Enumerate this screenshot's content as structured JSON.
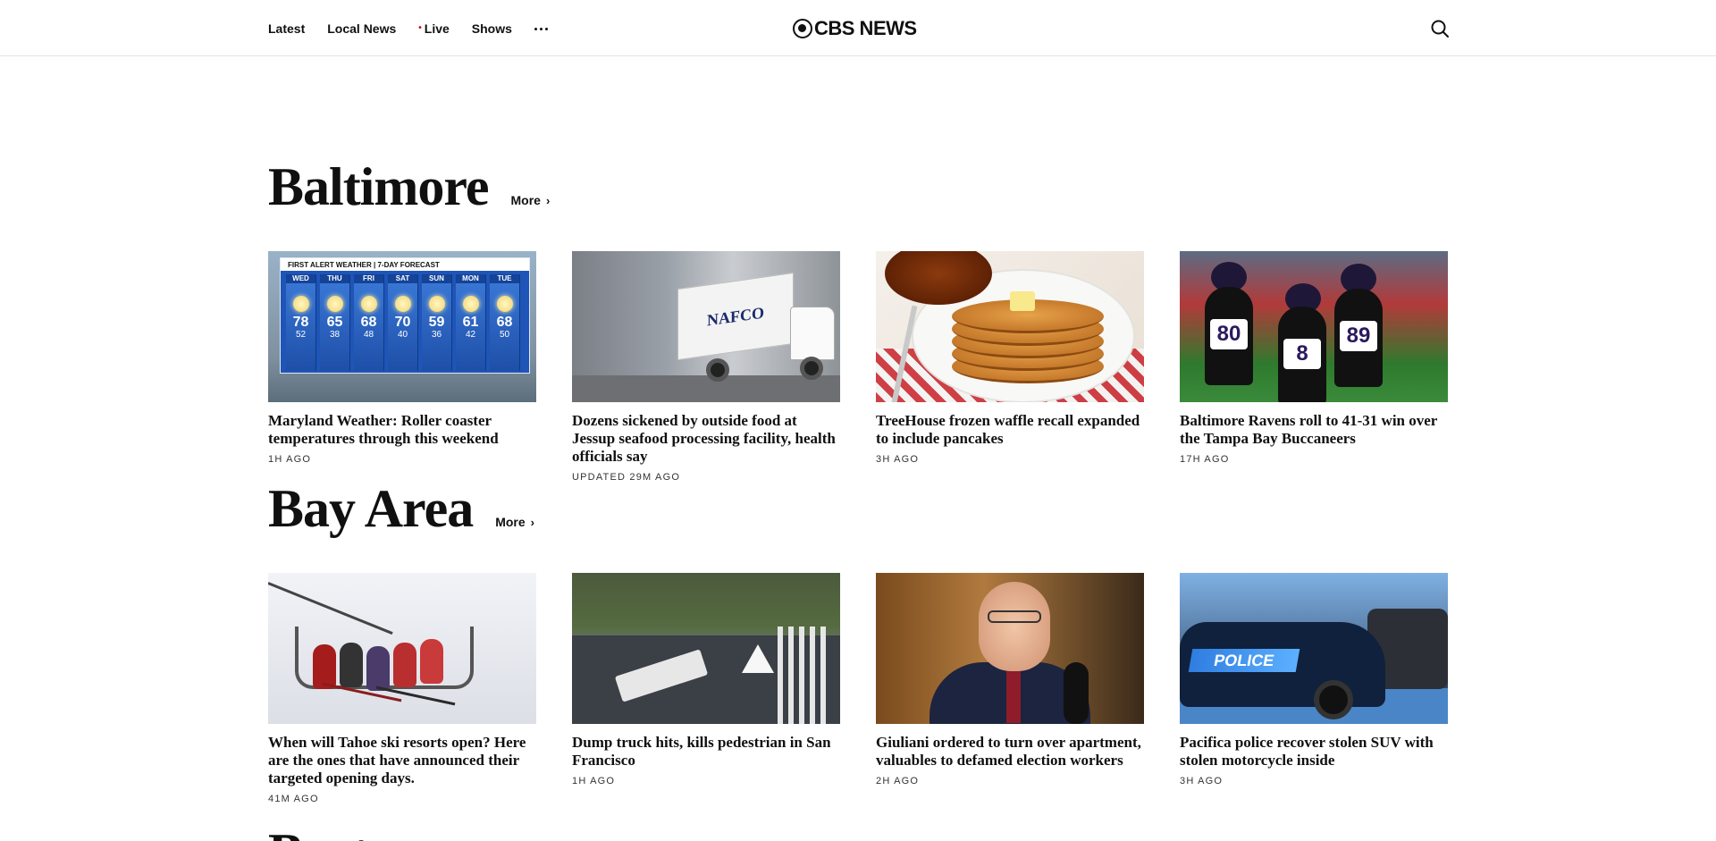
{
  "header": {
    "nav": [
      {
        "label": "Latest"
      },
      {
        "label": "Local News"
      },
      {
        "label": "Live",
        "live_dot": "•"
      },
      {
        "label": "Shows"
      }
    ],
    "logo_text": "CBS NEWS"
  },
  "sections": [
    {
      "title": "Baltimore",
      "more_label": "More",
      "cards": [
        {
          "headline": "Maryland Weather: Roller coaster temperatures through this weekend",
          "time": "1H AGO",
          "image": "weather-forecast-graphic"
        },
        {
          "headline": "Dozens sickened by outside food at Jessup seafood processing facility, health officials say",
          "time": "UPDATED 29M AGO",
          "image": "nafco-truck"
        },
        {
          "headline": "TreeHouse frozen waffle recall expanded to include pancakes",
          "time": "3H AGO",
          "image": "pancakes-with-syrup"
        },
        {
          "headline": "Baltimore Ravens roll to 41-31 win over the Tampa Bay Buccaneers",
          "time": "17H AGO",
          "image": "ravens-players"
        }
      ]
    },
    {
      "title": "Bay Area",
      "more_label": "More",
      "cards": [
        {
          "headline": "When will Tahoe ski resorts open? Here are the ones that have announced their targeted opening days.",
          "time": "41M AGO",
          "image": "ski-lift"
        },
        {
          "headline": "Dump truck hits, kills pedestrian in San Francisco",
          "time": "1H AGO",
          "image": "dump-truck-aerial"
        },
        {
          "headline": "Giuliani ordered to turn over apartment, valuables to defamed election workers",
          "time": "2H AGO",
          "image": "giuliani-portrait"
        },
        {
          "headline": "Pacifica police recover stolen SUV with stolen motorcycle inside",
          "time": "3H AGO",
          "image": "police-suv"
        }
      ]
    }
  ],
  "weather_graphic": {
    "banner": "FIRST ALERT WEATHER | 7-DAY FORECAST",
    "days": [
      {
        "day": "WED",
        "hi": "78",
        "lo": "52"
      },
      {
        "day": "THU",
        "hi": "65",
        "lo": "38"
      },
      {
        "day": "FRI",
        "hi": "68",
        "lo": "48"
      },
      {
        "day": "SAT",
        "hi": "70",
        "lo": "40"
      },
      {
        "day": "SUN",
        "hi": "59",
        "lo": "36"
      },
      {
        "day": "MON",
        "hi": "61",
        "lo": "42"
      },
      {
        "day": "TUE",
        "hi": "68",
        "lo": "50"
      }
    ]
  },
  "truck_label": "NAFCO",
  "ravens_numbers": [
    "80",
    "8",
    "89"
  ],
  "police_label": "POLICE",
  "next_section_partial": "Bost",
  "colors": {
    "live_dot": "#d0021b",
    "text": "#101010",
    "divider": "#e3e3e3"
  },
  "icons": {
    "search": "search-icon",
    "more": "more-dots-icon",
    "chevron": "chevron-right-icon"
  }
}
